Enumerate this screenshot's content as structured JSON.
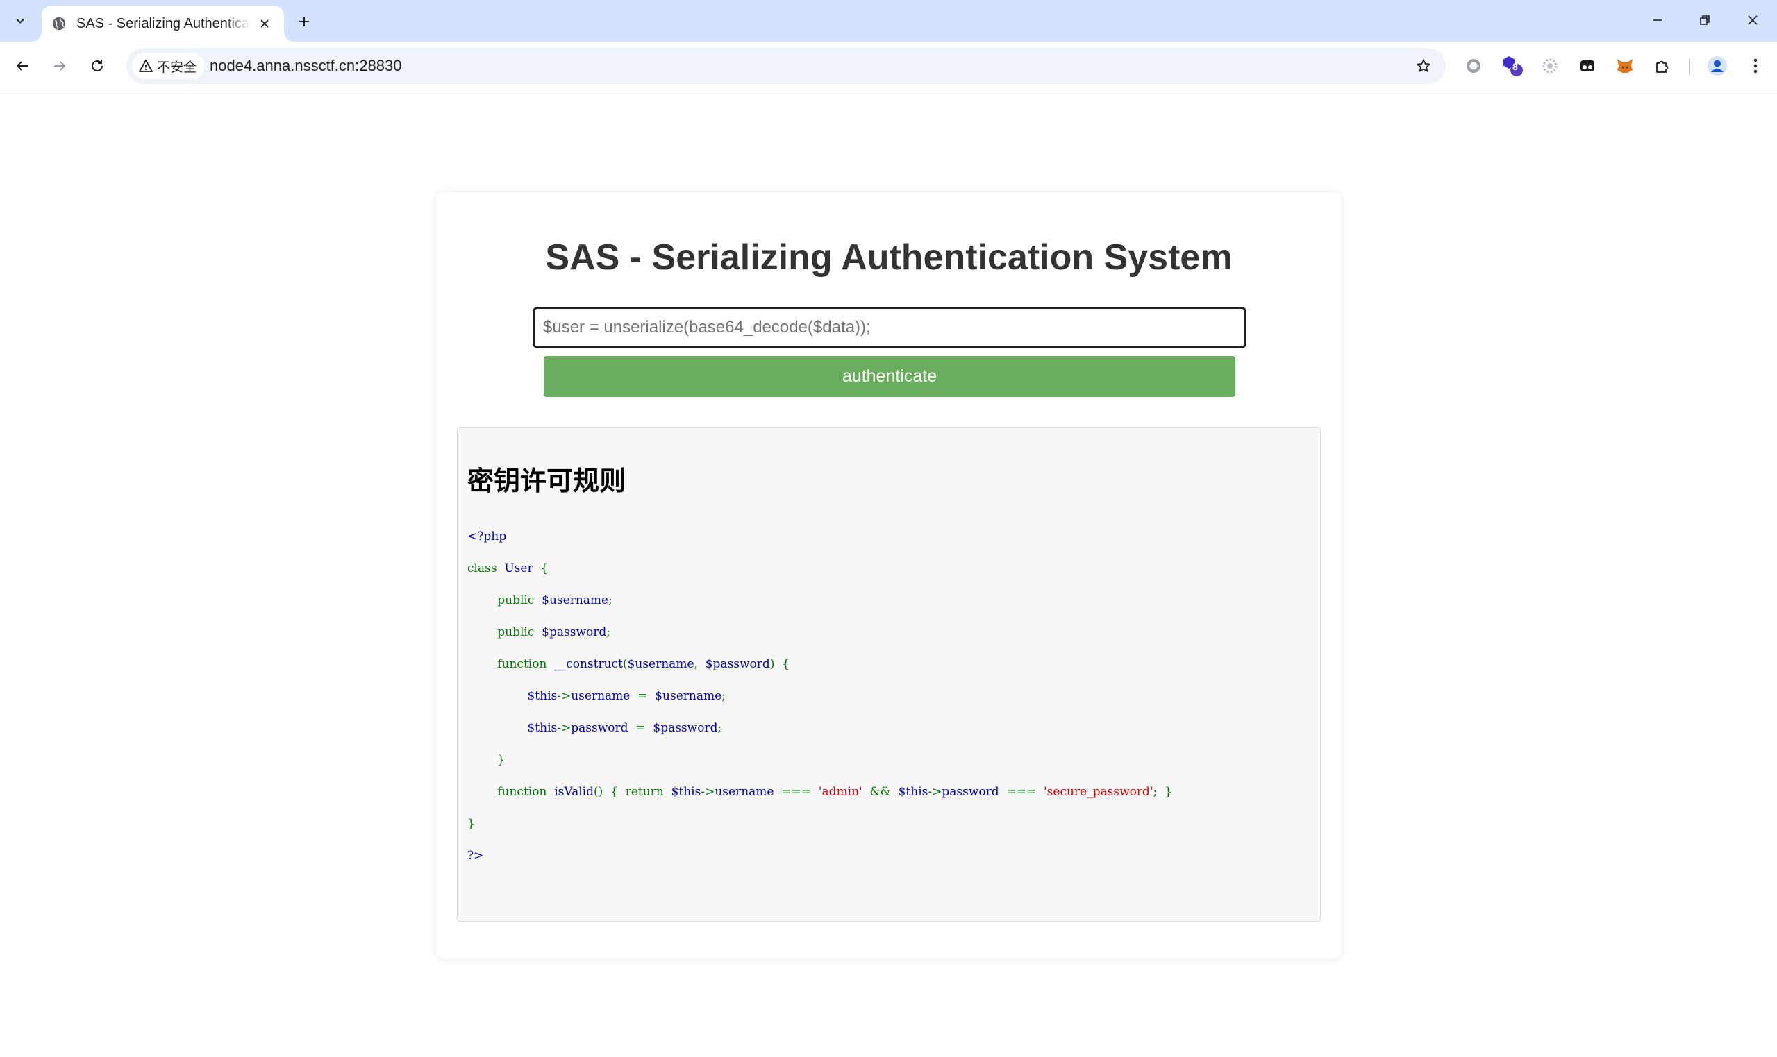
{
  "browser": {
    "tab": {
      "title": "SAS - Serializing Authenticati"
    },
    "address_bar": {
      "security_label": "不安全",
      "url": "node4.anna.nssctf.cn:28830"
    },
    "extensions": {
      "badge_count": "8"
    },
    "icons": [
      "chevron-down-icon",
      "globe-icon",
      "close-icon",
      "plus-icon",
      "minimize-icon",
      "restore-icon",
      "window-close-icon",
      "back-arrow-icon",
      "forward-arrow-icon",
      "reload-icon",
      "warning-icon",
      "star-icon",
      "puzzle-icon",
      "profile-icon",
      "kebab-menu-icon"
    ]
  },
  "page": {
    "title": "SAS - Serializing Authentication System",
    "input": {
      "placeholder": "$user = unserialize(base64_decode($data));",
      "value": ""
    },
    "button_label": "authenticate",
    "rules": {
      "heading": "密钥许可规则",
      "code": {
        "line1_open": "<?php",
        "line2_class": "class",
        "line2_name": "User",
        "line2_brace": "{",
        "line3_public": "public",
        "line3_var": "$username",
        "line3_semi": ";",
        "line4_public": "public",
        "line4_var": "$password",
        "line4_semi": ";",
        "line5_function": "function",
        "line5_name": "__construct",
        "line5_paren_open": "(",
        "line5_arg1": "$username",
        "line5_comma": ",",
        "line5_arg2": "$password",
        "line5_paren_close": ")",
        "line5_brace": "{",
        "line6_this": "$this",
        "line6_arrow": "->",
        "line6_prop": "username",
        "line6_eq": "=",
        "line6_val": "$username",
        "line6_semi": ";",
        "line7_this": "$this",
        "line7_arrow": "->",
        "line7_prop": "password",
        "line7_eq": "=",
        "line7_val": "$password",
        "line7_semi": ";",
        "line8_brace": "}",
        "line9_function": "function",
        "line9_name": "isValid",
        "line9_parens": "()",
        "line9_brace_open": "{",
        "line9_return": "return",
        "line9_this1": "$this",
        "line9_arrow1": "->",
        "line9_prop1": "username",
        "line9_op1": "===",
        "line9_str1": "'admin'",
        "line9_and": "&&",
        "line9_this2": "$this",
        "line9_arrow2": "->",
        "line9_prop2": "password",
        "line9_op2": "===",
        "line9_str2": "'secure_password'",
        "line9_semi": ";",
        "line9_brace_close": "}",
        "line10_brace": "}",
        "line11_close": "?>"
      }
    }
  },
  "colors": {
    "chrome_titlebar": "#d3e3fd",
    "button_green": "#68ad5c",
    "php_keyword": "#007700",
    "php_default": "#0000bb",
    "php_string": "#dd0000"
  }
}
